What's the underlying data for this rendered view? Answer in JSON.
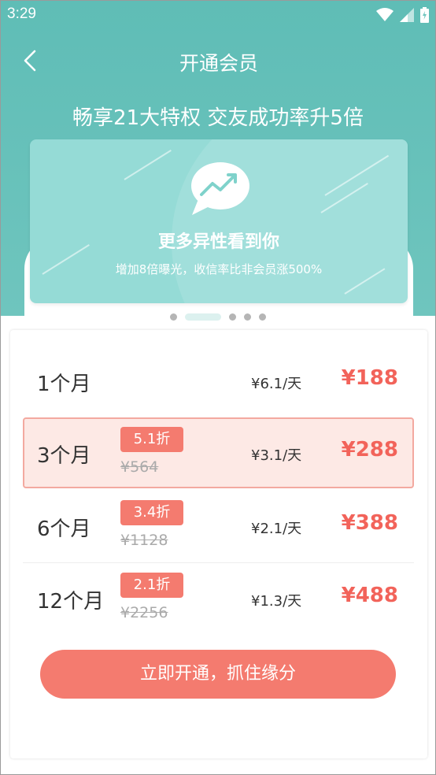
{
  "status_bar": {
    "time": "3:29"
  },
  "nav": {
    "title": "开通会员"
  },
  "hero": {
    "tagline": "畅享21大特权 交友成功率升5倍"
  },
  "banner": {
    "title": "更多异性看到你",
    "description": "增加8倍曝光，收信率比非会员涨500%"
  },
  "carousel": {
    "page_count": 4,
    "active_index": 1
  },
  "plans": [
    {
      "period": "1个月",
      "badge": "",
      "original_price": "",
      "daily_price": "¥6.1/天",
      "price": "¥188",
      "selected": false
    },
    {
      "period": "3个月",
      "badge": "5.1折",
      "original_price": "¥564",
      "daily_price": "¥3.1/天",
      "price": "¥288",
      "selected": true
    },
    {
      "period": "6个月",
      "badge": "3.4折",
      "original_price": "¥1128",
      "daily_price": "¥2.1/天",
      "price": "¥388",
      "selected": false
    },
    {
      "period": "12个月",
      "badge": "2.1折",
      "original_price": "¥2256",
      "daily_price": "¥1.3/天",
      "price": "¥488",
      "selected": false
    }
  ],
  "cta": {
    "label": "立即开通，抓住缘分"
  },
  "colors": {
    "hero_teal": "#5fbdb6",
    "banner_teal": "#95dbd6",
    "accent_coral": "#f47b6f",
    "price_red": "#f2635a",
    "selected_bg": "#fde9e5"
  }
}
